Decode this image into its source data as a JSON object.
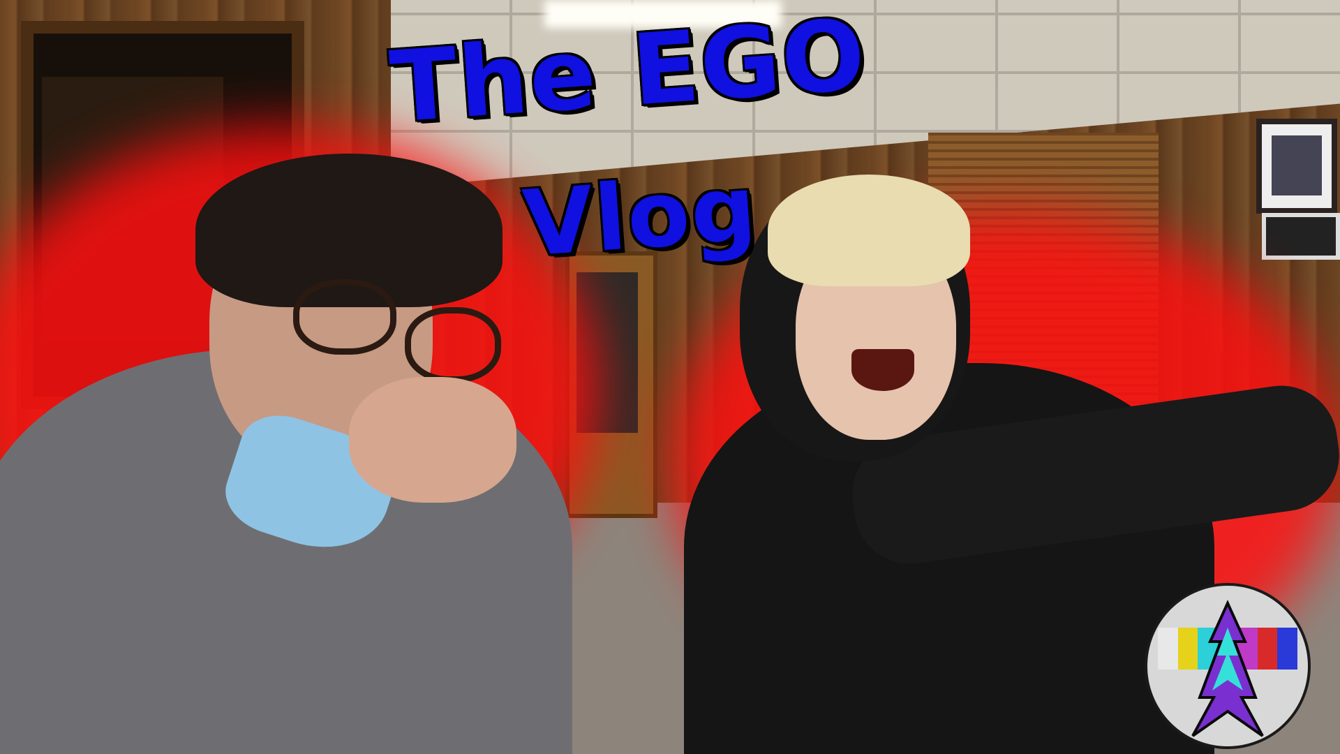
{
  "thumbnail": {
    "title_line1": "The EGO",
    "title_line2": "Vlog",
    "title_color": "#1010e0",
    "glow_color": "#ff1010"
  },
  "logo": {
    "icon": "test-pattern-figure-icon",
    "bar_colors": [
      "#e8e8e8",
      "#e6d21a",
      "#2bd0d8",
      "#2bb84a",
      "#c03ac8",
      "#d82a2a",
      "#2a3ad8"
    ]
  }
}
